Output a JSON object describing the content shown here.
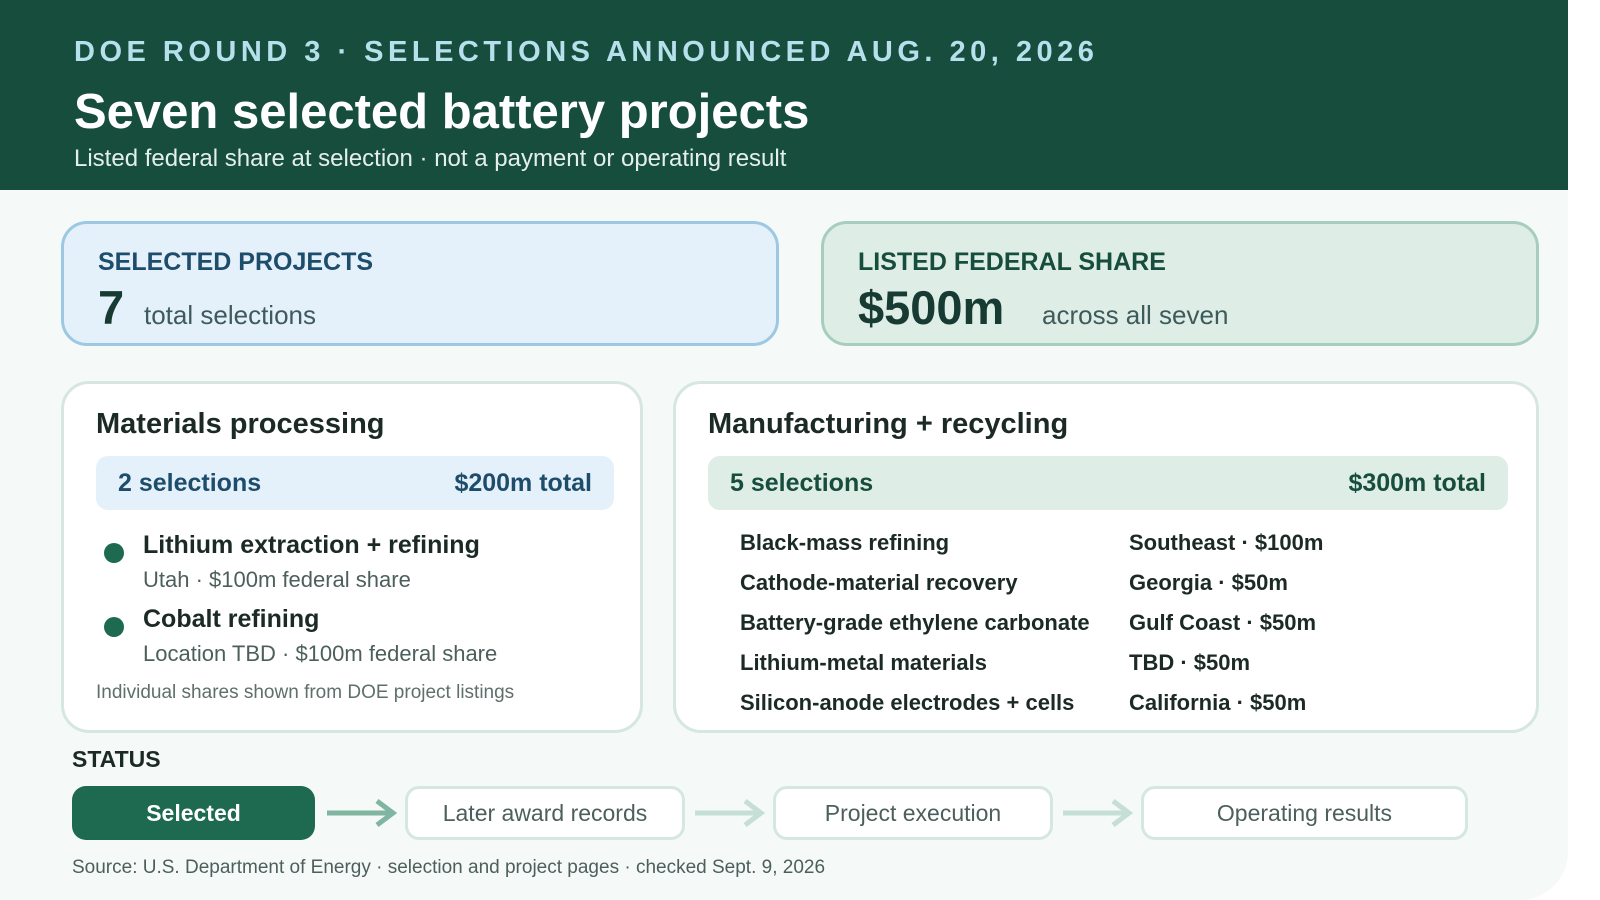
{
  "header": {
    "kicker": "DOE ROUND 3 · SELECTIONS ANNOUNCED AUG. 20, 2026",
    "title": "Seven selected battery projects",
    "subtitle": "Listed federal share at selection · not a payment or operating result"
  },
  "stats": {
    "projects": {
      "label": "SELECTED PROJECTS",
      "value": "7",
      "note": "total selections"
    },
    "share": {
      "label": "LISTED FEDERAL SHARE",
      "value": "$500m",
      "note": "across all seven"
    }
  },
  "materials": {
    "title": "Materials processing",
    "count": "2 selections",
    "total": "$200m total",
    "projects": [
      {
        "name": "Lithium extraction + refining",
        "meta": "Utah · $100m federal share"
      },
      {
        "name": "Cobalt refining",
        "meta": "Location TBD · $100m federal share"
      }
    ],
    "note": "Individual shares shown from DOE project listings"
  },
  "manufacturing": {
    "title": "Manufacturing + recycling",
    "count": "5 selections",
    "total": "$300m total",
    "projects": [
      {
        "name": "Black-mass refining",
        "loc": "Southeast · $100m"
      },
      {
        "name": "Cathode-material recovery",
        "loc": "Georgia · $50m"
      },
      {
        "name": "Battery-grade ethylene carbonate",
        "loc": "Gulf Coast · $50m"
      },
      {
        "name": "Lithium-metal materials",
        "loc": "TBD · $50m"
      },
      {
        "name": "Silicon-anode electrodes + cells",
        "loc": "California · $50m"
      }
    ]
  },
  "status": {
    "label": "STATUS",
    "steps": [
      "Selected",
      "Later award records",
      "Project execution",
      "Operating results"
    ],
    "active_color": "#1e6a50"
  },
  "source": "Source: U.S. Department of Energy · selection and project pages · checked Sept. 9, 2026",
  "colors": {
    "header_bg": "#174d3d",
    "kicker": "#b6e0ec",
    "blue_card": "#e4f1fb",
    "green_card": "#deeee7",
    "accent_green": "#1e6a50"
  }
}
